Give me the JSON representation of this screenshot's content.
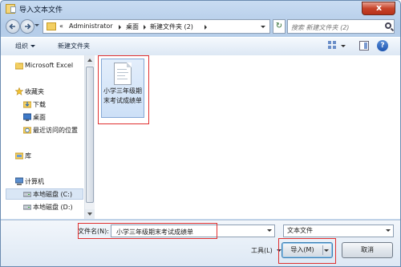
{
  "window": {
    "title": "导入文本文件"
  },
  "nav": {
    "address": {
      "prefix": "«",
      "segments": [
        "Administrator",
        "桌面",
        "新建文件夹 (2)"
      ]
    },
    "search_placeholder": "搜索 新建文件夹 (2)"
  },
  "toolbar": {
    "organize_label": "组织",
    "new_folder_label": "新建文件夹",
    "help_label": "?"
  },
  "sidebar": {
    "items": [
      {
        "label": "Microsoft Excel"
      },
      {
        "label": "收藏夹"
      },
      {
        "label": "下载"
      },
      {
        "label": "桌面"
      },
      {
        "label": "最近访问的位置"
      },
      {
        "label": "库"
      },
      {
        "label": "计算机"
      },
      {
        "label": "本地磁盘 (C:)"
      },
      {
        "label": "本地磁盘 (D:)"
      }
    ],
    "selected_index": 7
  },
  "content": {
    "files": [
      {
        "name": "小学三年级期末考试成绩单",
        "icon": "text-document-icon"
      }
    ]
  },
  "bottom": {
    "filename_label": "文件名(N):",
    "filename_value": "小学三年级期末考试成绩单",
    "filetype_value": "文本文件",
    "tools_label": "工具(L)",
    "import_label": "导入(M)",
    "cancel_label": "取消"
  },
  "colors": {
    "highlight": "#e03030",
    "selection": "#cde0f7",
    "window_frame": "#b5cde9"
  }
}
